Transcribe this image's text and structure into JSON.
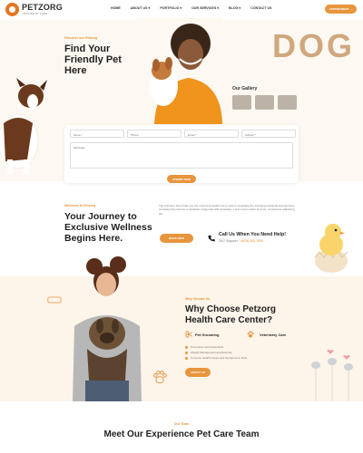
{
  "brand": {
    "name": "PETZORG",
    "tagline": "TRUSTED BY CARE"
  },
  "nav": {
    "items": [
      "HOME",
      "ABOUT US ▾",
      "PORTFOLIO ▾",
      "OUR SERVICES ▾",
      "BLOG ▾",
      "CONTACT US"
    ],
    "cta": "APPOINTMENT →"
  },
  "hero": {
    "eyebrow": "Discover our Petzorg",
    "title": "Find Your Friendly Pet Here",
    "decor_text": "DOG",
    "gallery_label": "Our Gallery"
  },
  "form": {
    "name_placeholder": "Name *",
    "phone_placeholder": "Phone",
    "email_placeholder": "Email *",
    "subject_placeholder": "Subject *",
    "message_placeholder": "Message",
    "submit_label": "SUBMIT NOW"
  },
  "welcome": {
    "eyebrow": "Welcome to Petzorg",
    "title": "Your Journey to Exclusive Wellness Begins Here.",
    "body": "The Furniture store finds you the most of innovation tie to care to spreading the swinging functional and premium, considered by diverse or attraction supported with necessary. Lorem ipsum dolor sit amet, consectetur adipiscing elit.",
    "cta": "BOOK NOW",
    "call_title": "Call Us When You Need Help!",
    "call_prefix": "24/7 Support:",
    "call_number": "+(628) 455-7890"
  },
  "why": {
    "eyebrow": "Why Choose Us",
    "title": "Why Choose Petzorg Health Care Center?",
    "features": [
      "Pet Grooming",
      "Veterinary Care"
    ],
    "bullets": [
      "Preventive Care Essentials",
      "Weight Management and Exercise",
      "Common Health Issues and Symptoms in Pets"
    ],
    "cta": "ABOUT US"
  },
  "team": {
    "eyebrow": "Our Team",
    "title": "Meet Our Experience Pet Care Team"
  },
  "colors": {
    "accent": "#e8953d",
    "cream": "#fdf8f1",
    "peach": "#fdf4ea"
  }
}
